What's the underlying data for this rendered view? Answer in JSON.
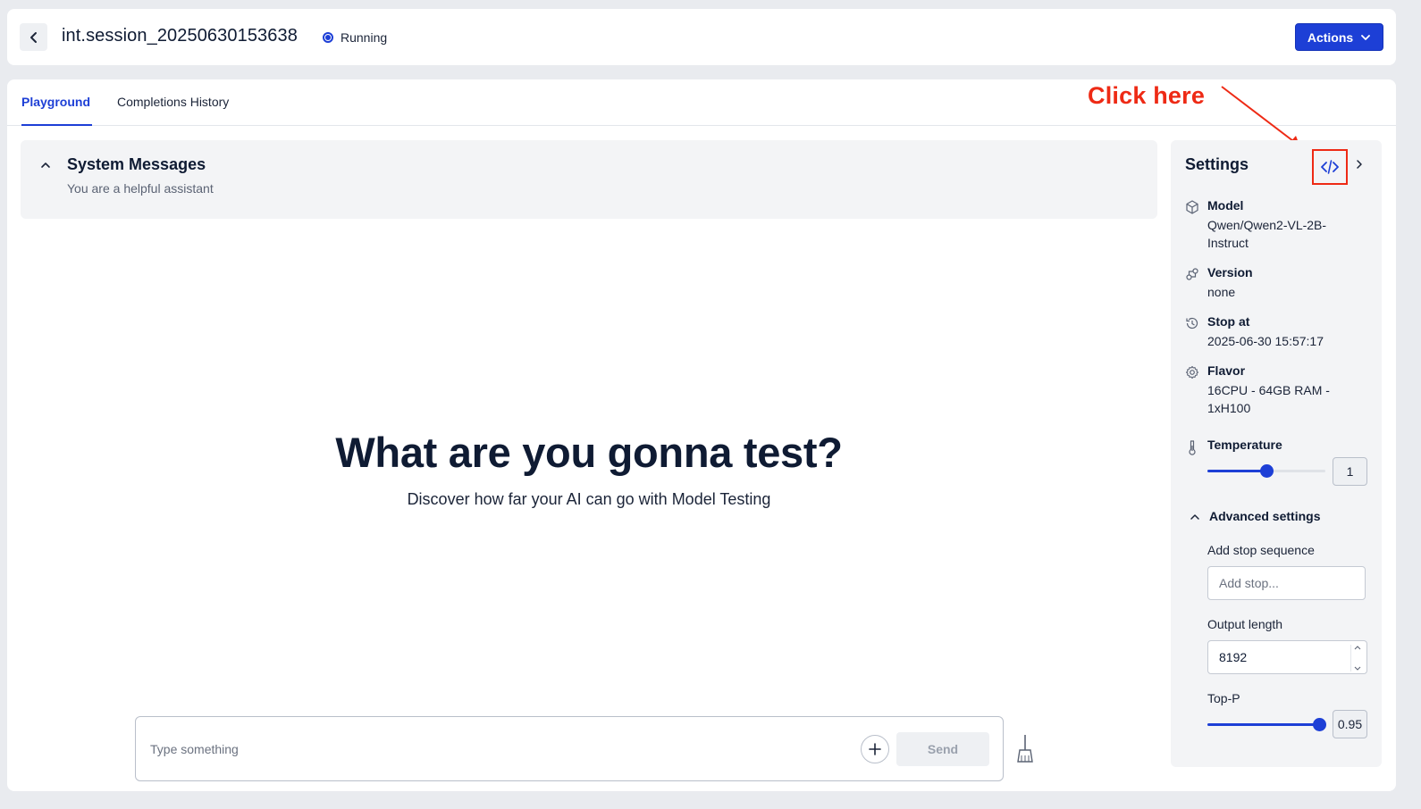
{
  "header": {
    "session_title": "int.session_20250630153638",
    "status": "Running",
    "actions_label": "Actions"
  },
  "tabs": [
    {
      "label": "Playground",
      "active": true
    },
    {
      "label": "Completions History",
      "active": false
    }
  ],
  "annotation": {
    "text": "Click here"
  },
  "system_messages": {
    "title": "System Messages",
    "text": "You are a helpful assistant"
  },
  "hero": {
    "title": "What are you gonna test?",
    "subtitle": "Discover how far your AI can go with Model Testing"
  },
  "chat": {
    "placeholder": "Type something",
    "send_label": "Send"
  },
  "settings": {
    "title": "Settings",
    "model": {
      "label": "Model",
      "value": "Qwen/Qwen2-VL-2B-Instruct"
    },
    "version": {
      "label": "Version",
      "value": "none"
    },
    "stop_at": {
      "label": "Stop at",
      "value": "2025-06-30 15:57:17"
    },
    "flavor": {
      "label": "Flavor",
      "value": "16CPU - 64GB RAM - 1xH100"
    },
    "temperature": {
      "label": "Temperature",
      "value": "1",
      "fraction": 0.5
    },
    "advanced": {
      "title": "Advanced settings",
      "stop_sequence_label": "Add stop sequence",
      "stop_sequence_placeholder": "Add stop...",
      "output_length_label": "Output length",
      "output_length_value": "8192",
      "top_p_label": "Top-P",
      "top_p_value": "0.95",
      "top_p_fraction": 0.95
    }
  },
  "colors": {
    "accent": "#1d3fd6",
    "annotation": "#ee2a15"
  }
}
